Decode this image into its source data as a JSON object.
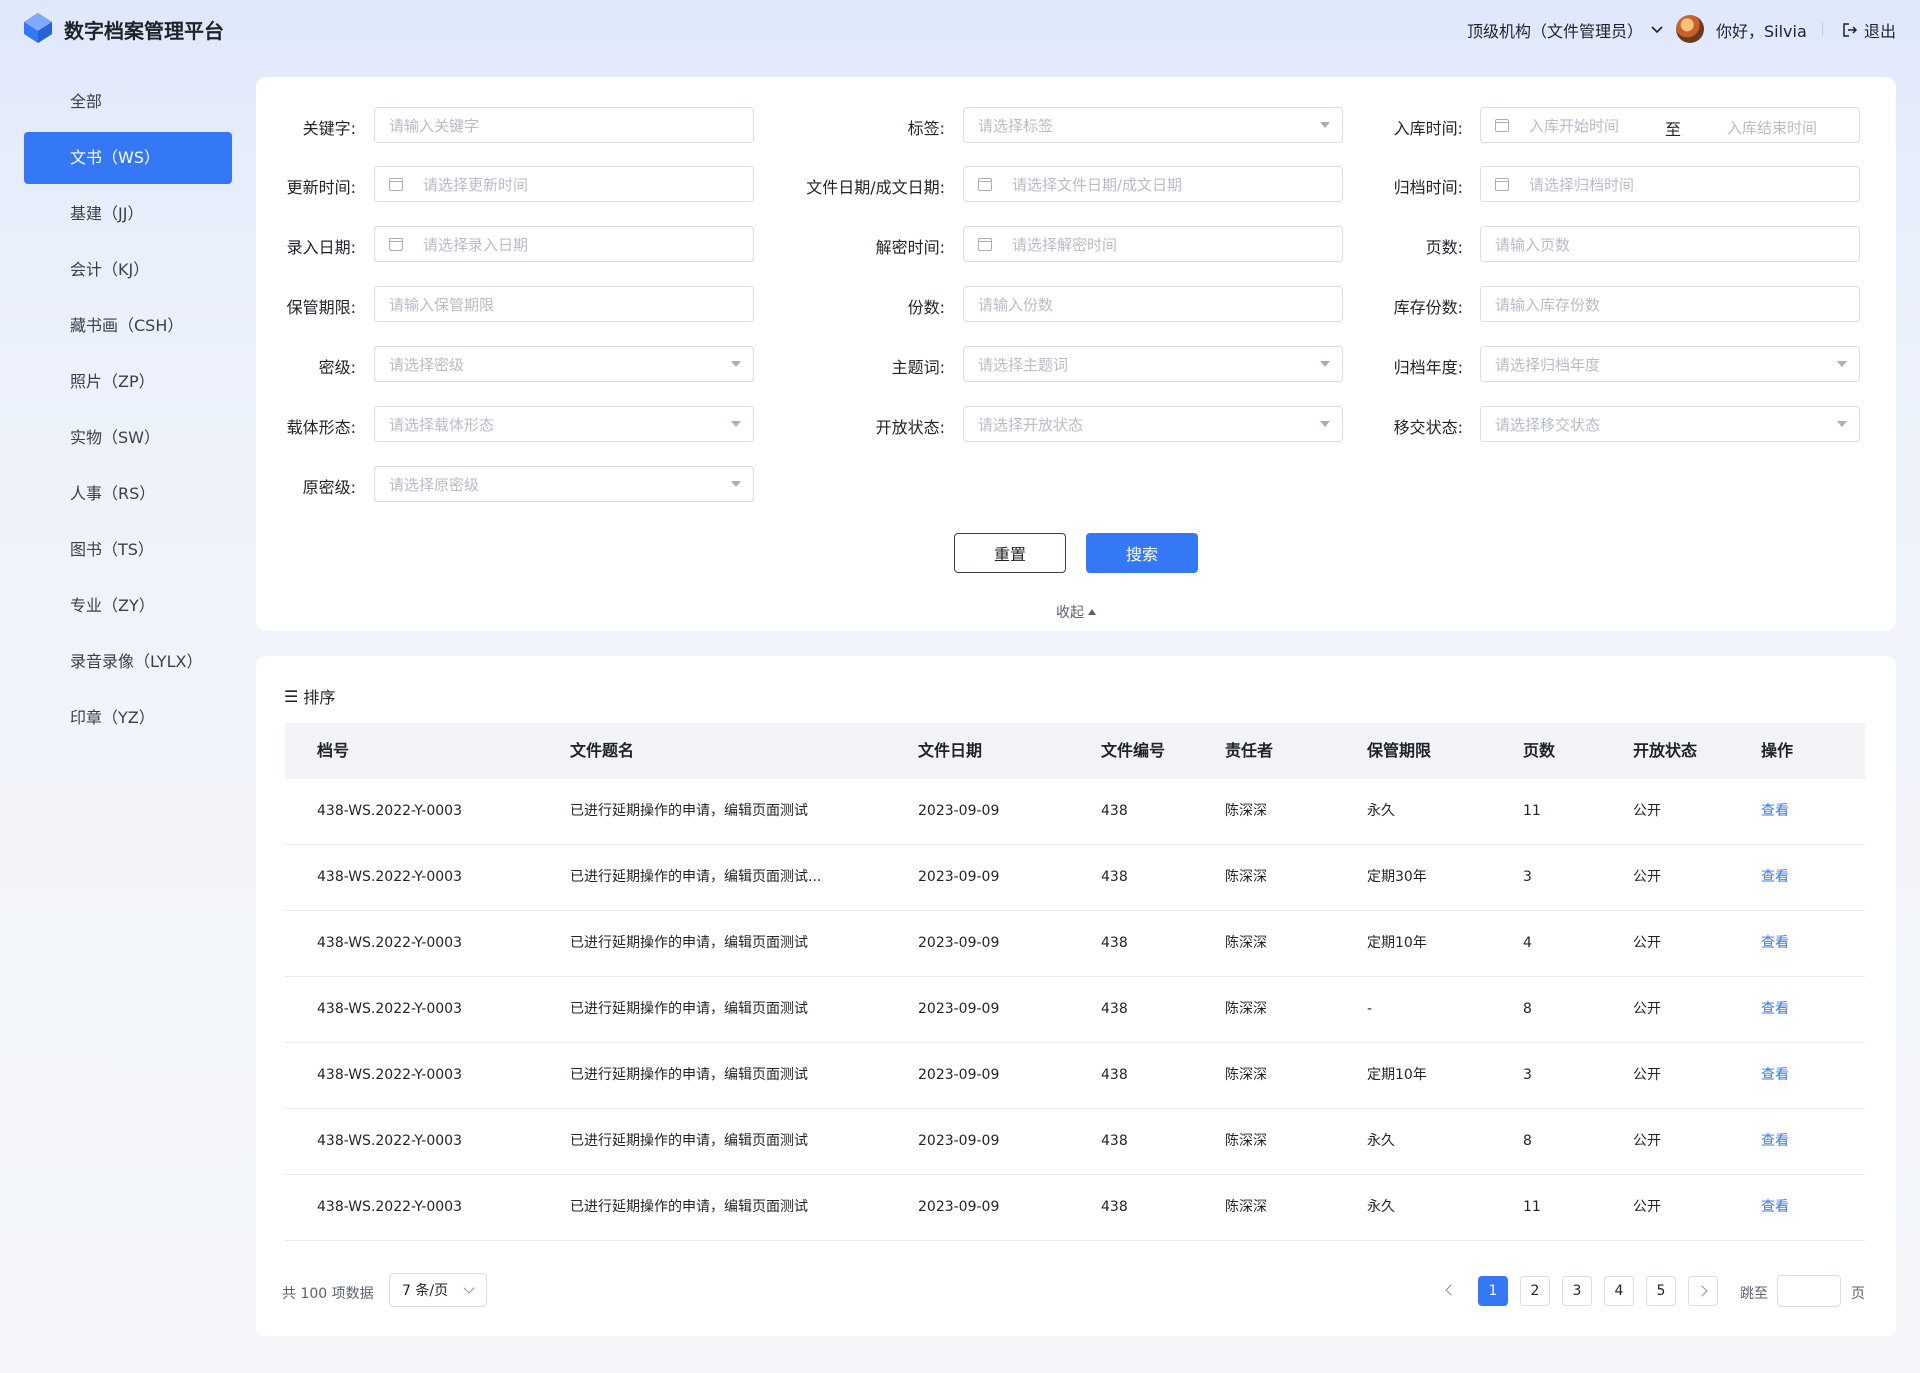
{
  "header": {
    "brand": "数字档案管理平台",
    "org": "顶级机构（文件管理员）",
    "greeting": "你好，Silvia",
    "logout": "退出"
  },
  "sidebar": {
    "items": [
      {
        "label": "全部"
      },
      {
        "label": "文书（WS）",
        "active": true
      },
      {
        "label": "基建（JJ）"
      },
      {
        "label": "会计（KJ）"
      },
      {
        "label": "藏书画（CSH）"
      },
      {
        "label": "照片（ZP）"
      },
      {
        "label": "实物（SW）"
      },
      {
        "label": "人事（RS）"
      },
      {
        "label": "图书（TS）"
      },
      {
        "label": "专业（ZY）"
      },
      {
        "label": "录音录像（LYLX）"
      },
      {
        "label": "印章（YZ）"
      }
    ]
  },
  "filters": {
    "keyword": {
      "label": "关键字:",
      "placeholder": "请输入关键字"
    },
    "tag": {
      "label": "标签:",
      "placeholder": "请选择标签"
    },
    "storage_time": {
      "label": "入库时间:",
      "start": "入库开始时间",
      "sep": "至",
      "end": "入库结束时间"
    },
    "update_time": {
      "label": "更新时间:",
      "placeholder": "请选择更新时间"
    },
    "file_date": {
      "label": "文件日期/成文日期:",
      "placeholder": "请选择文件日期/成文日期"
    },
    "archive_time": {
      "label": "归档时间:",
      "placeholder": "请选择归档时间"
    },
    "entry_date": {
      "label": "录入日期:",
      "placeholder": "请选择录入日期"
    },
    "declassify_time": {
      "label": "解密时间:",
      "placeholder": "请选择解密时间"
    },
    "pages": {
      "label": "页数:",
      "placeholder": "请输入页数"
    },
    "retention": {
      "label": "保管期限:",
      "placeholder": "请输入保管期限"
    },
    "copies": {
      "label": "份数:",
      "placeholder": "请输入份数"
    },
    "stock_copies": {
      "label": "库存份数:",
      "placeholder": "请输入库存份数"
    },
    "secret_level": {
      "label": "密级:",
      "placeholder": "请选择密级"
    },
    "subject": {
      "label": "主题词:",
      "placeholder": "请选择主题词"
    },
    "archive_year": {
      "label": "归档年度:",
      "placeholder": "请选择归档年度"
    },
    "carrier": {
      "label": "载体形态:",
      "placeholder": "请选择载体形态"
    },
    "open_status": {
      "label": "开放状态:",
      "placeholder": "请选择开放状态"
    },
    "transfer_status": {
      "label": "移交状态:",
      "placeholder": "请选择移交状态"
    },
    "orig_secret": {
      "label": "原密级:",
      "placeholder": "请选择原密级"
    }
  },
  "actions": {
    "reset": "重置",
    "search": "搜索",
    "collapse": "收起"
  },
  "table": {
    "sort_icon": "☰",
    "sort_label": "排序",
    "columns": [
      "档号",
      "文件题名",
      "文件日期",
      "文件编号",
      "责任者",
      "保管期限",
      "页数",
      "开放状态",
      "操作"
    ],
    "rows": [
      [
        "438-WS.2022-Y-0003",
        "已进行延期操作的申请，编辑页面测试",
        "2023-09-09",
        "438",
        "陈深深",
        "永久",
        "11",
        "公开",
        "查看"
      ],
      [
        "438-WS.2022-Y-0003",
        "已进行延期操作的申请，编辑页面测试...",
        "2023-09-09",
        "438",
        "陈深深",
        "定期30年",
        "3",
        "公开",
        "查看"
      ],
      [
        "438-WS.2022-Y-0003",
        "已进行延期操作的申请，编辑页面测试",
        "2023-09-09",
        "438",
        "陈深深",
        "定期10年",
        "4",
        "公开",
        "查看"
      ],
      [
        "438-WS.2022-Y-0003",
        "已进行延期操作的申请，编辑页面测试",
        "2023-09-09",
        "438",
        "陈深深",
        "-",
        "8",
        "公开",
        "查看"
      ],
      [
        "438-WS.2022-Y-0003",
        "已进行延期操作的申请，编辑页面测试",
        "2023-09-09",
        "438",
        "陈深深",
        "定期10年",
        "3",
        "公开",
        "查看"
      ],
      [
        "438-WS.2022-Y-0003",
        "已进行延期操作的申请，编辑页面测试",
        "2023-09-09",
        "438",
        "陈深深",
        "永久",
        "8",
        "公开",
        "查看"
      ],
      [
        "438-WS.2022-Y-0003",
        "已进行延期操作的申请，编辑页面测试",
        "2023-09-09",
        "438",
        "陈深深",
        "永久",
        "11",
        "公开",
        "查看"
      ]
    ]
  },
  "pagination": {
    "total": "共 100 项数据",
    "page_size": "7 条/页",
    "pages": [
      "1",
      "2",
      "3",
      "4",
      "5"
    ],
    "current": "1",
    "jump_label": "跳至",
    "page_suffix": "页"
  },
  "colors": {
    "primary": "#3478f6"
  }
}
